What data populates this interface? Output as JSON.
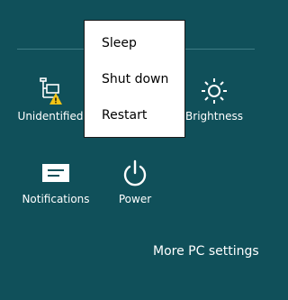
{
  "settings": {
    "network_label": "Unidentified",
    "brightness_label": "Brightness",
    "notifications_label": "Notifications",
    "power_label": "Power",
    "more_label": "More PC settings"
  },
  "power_menu": {
    "items": [
      {
        "label": "Sleep"
      },
      {
        "label": "Shut down"
      },
      {
        "label": "Restart"
      }
    ]
  },
  "colors": {
    "background": "#10505a",
    "menu_background": "#ffffff",
    "warning": "#f2c316"
  },
  "icons": {
    "network": "network-warning-icon",
    "brightness": "sun-icon",
    "notifications": "notification-icon",
    "power": "power-icon"
  }
}
